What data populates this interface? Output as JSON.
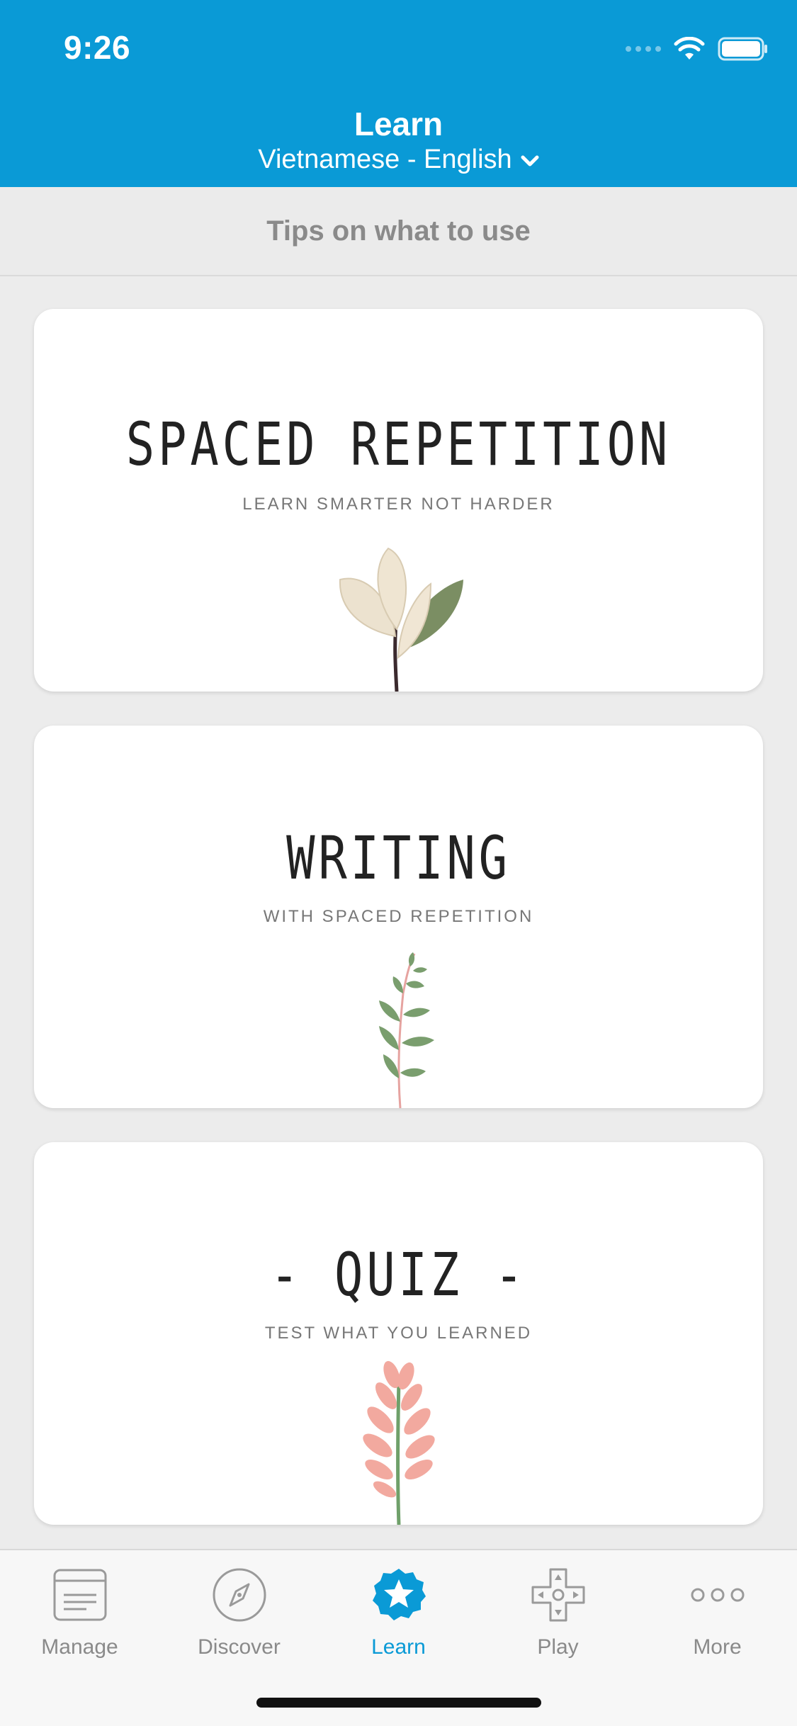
{
  "status_bar": {
    "time": "9:26"
  },
  "header": {
    "title": "Learn",
    "language_pair": "Vietnamese - English"
  },
  "tips": {
    "label": "Tips on what to use"
  },
  "cards": [
    {
      "title": "SPACED REPETITION",
      "subtitle": "LEARN SMARTER NOT HARDER"
    },
    {
      "title": "WRITING",
      "subtitle": "WITH SPACED REPETITION"
    },
    {
      "title": "- QUIZ -",
      "subtitle": "TEST WHAT YOU LEARNED"
    }
  ],
  "tabbar": {
    "items": [
      {
        "label": "Manage",
        "icon": "notebook-icon"
      },
      {
        "label": "Discover",
        "icon": "compass-icon"
      },
      {
        "label": "Learn",
        "icon": "star-badge-icon",
        "active": true
      },
      {
        "label": "Play",
        "icon": "gamepad-icon"
      },
      {
        "label": "More",
        "icon": "more-dots-icon"
      }
    ]
  },
  "colors": {
    "accent": "#0a9ad6",
    "background": "#ececec",
    "inactive": "#8a8a8a"
  }
}
